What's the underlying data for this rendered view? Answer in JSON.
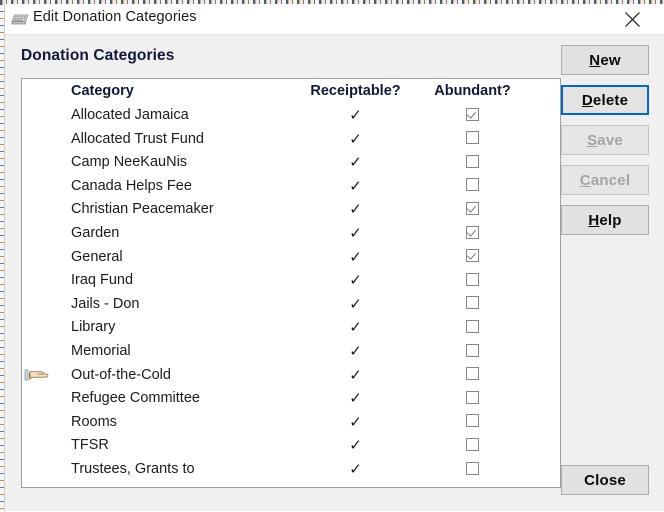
{
  "window": {
    "title": "Edit Donation Categories",
    "icon": "keyboard-icon",
    "close_label": "✕"
  },
  "heading": "Donation Categories",
  "table": {
    "columns": [
      "Category",
      "Receiptable?",
      "Abundant?"
    ],
    "rows": [
      {
        "category": "Allocated Jamaica",
        "receiptable": true,
        "abundant": true
      },
      {
        "category": "Allocated Trust Fund",
        "receiptable": true,
        "abundant": false
      },
      {
        "category": "Camp NeeKauNis",
        "receiptable": true,
        "abundant": false
      },
      {
        "category": "Canada Helps Fee",
        "receiptable": true,
        "abundant": false
      },
      {
        "category": "Christian Peacemaker",
        "receiptable": true,
        "abundant": true
      },
      {
        "category": "Garden",
        "receiptable": true,
        "abundant": true
      },
      {
        "category": "General",
        "receiptable": true,
        "abundant": true
      },
      {
        "category": "Iraq Fund",
        "receiptable": true,
        "abundant": false
      },
      {
        "category": "Jails - Don",
        "receiptable": true,
        "abundant": false
      },
      {
        "category": "Library",
        "receiptable": true,
        "abundant": false
      },
      {
        "category": "Memorial",
        "receiptable": true,
        "abundant": false
      },
      {
        "category": "Out-of-the-Cold",
        "receiptable": true,
        "abundant": false,
        "selected": true
      },
      {
        "category": "Refugee Committee",
        "receiptable": true,
        "abundant": false
      },
      {
        "category": "Rooms",
        "receiptable": true,
        "abundant": false
      },
      {
        "category": "TFSR",
        "receiptable": true,
        "abundant": false
      },
      {
        "category": "Trustees, Grants to",
        "receiptable": true,
        "abundant": false
      }
    ],
    "checkmark_glyph": "✓",
    "selected_row_indicator": "pointing-hand-icon"
  },
  "buttons": {
    "new": {
      "label": "New",
      "mnemonic": "N",
      "state": "enabled"
    },
    "delete": {
      "label": "Delete",
      "mnemonic": "D",
      "state": "focused"
    },
    "save": {
      "label": "Save",
      "mnemonic": "S",
      "state": "disabled"
    },
    "cancel": {
      "label": "Cancel",
      "mnemonic": "C",
      "state": "disabled"
    },
    "help": {
      "label": "Help",
      "mnemonic": "H",
      "state": "enabled"
    },
    "close": {
      "label": "Close",
      "state": "enabled"
    }
  },
  "colors": {
    "dialog_background": "#f0f0f0",
    "titlebar_background": "#ffffff",
    "list_background": "#ffffff",
    "heading_text": "#11183a",
    "focus_border": "#0a64c8",
    "button_face": "#e1e1e1",
    "disabled_text": "#a3a3a3",
    "border": "#a0a0a0"
  }
}
